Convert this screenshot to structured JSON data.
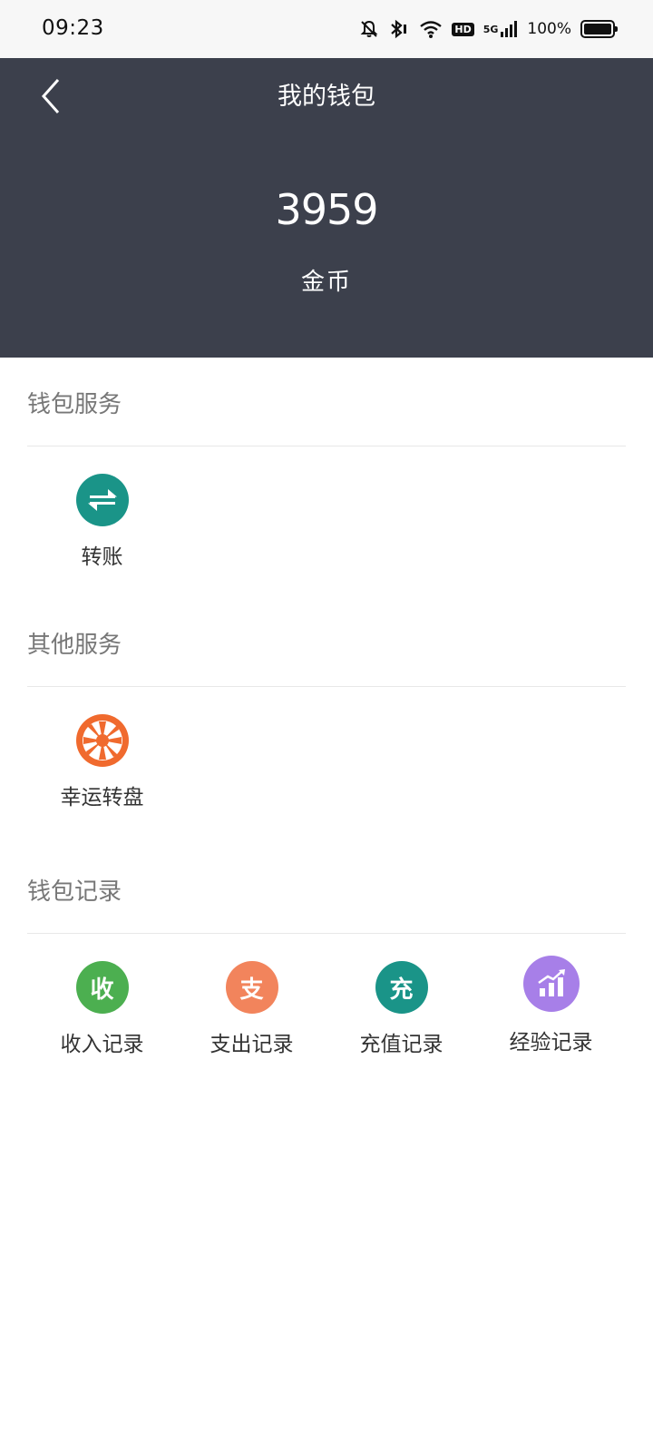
{
  "status_bar": {
    "time": "09:23",
    "hd_label": "HD",
    "network_label": "5G",
    "battery_percent": "100%",
    "battery_level": 1.0,
    "icons": [
      "bell-off-icon",
      "bluetooth-icon",
      "wifi-icon",
      "hd-icon",
      "cellular-signal-icon",
      "battery-icon"
    ]
  },
  "header": {
    "title": "我的钱包",
    "balance": "3959",
    "balance_unit": "金币",
    "background_color": "#3c404c"
  },
  "sections": {
    "wallet_services": {
      "title": "钱包服务",
      "items": [
        {
          "label": "转账",
          "icon": "transfer-arrows-icon",
          "color": "#1a9488"
        }
      ]
    },
    "other_services": {
      "title": "其他服务",
      "items": [
        {
          "label": "幸运转盘",
          "icon": "lucky-wheel-icon",
          "color": "#f06a2e"
        }
      ]
    },
    "wallet_records": {
      "title": "钱包记录",
      "items": [
        {
          "label": "收入记录",
          "icon_text": "收",
          "icon": "income-icon",
          "color": "#4caf50"
        },
        {
          "label": "支出记录",
          "icon_text": "支",
          "icon": "expense-icon",
          "color": "#f2845c"
        },
        {
          "label": "充值记录",
          "icon_text": "充",
          "icon": "recharge-icon",
          "color": "#1a9488"
        },
        {
          "label": "经验记录",
          "icon": "bar-chart-icon",
          "color": "#a77fe8"
        }
      ]
    }
  }
}
